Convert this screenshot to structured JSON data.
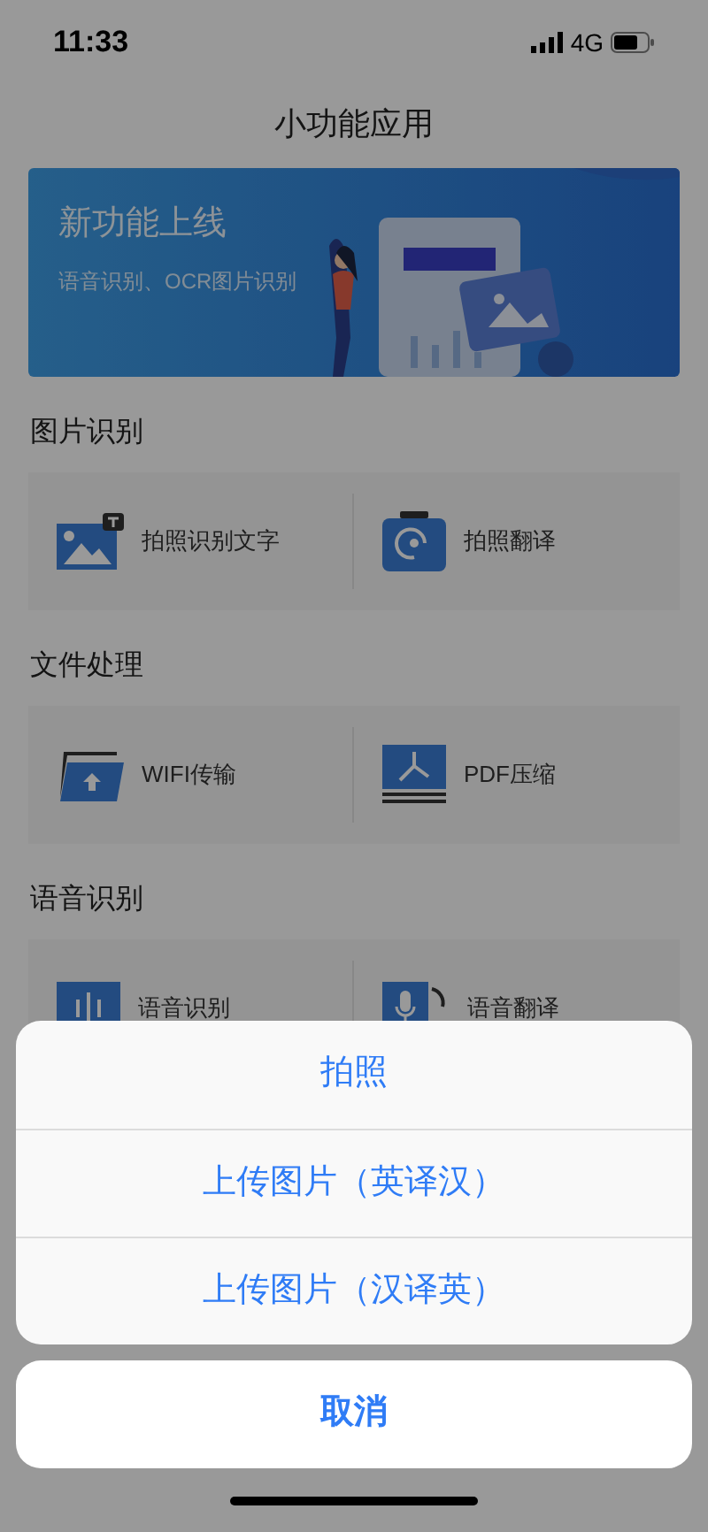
{
  "status_bar": {
    "time": "11:33",
    "network": "4G"
  },
  "title": "小功能应用",
  "banner": {
    "headline": "新功能上线",
    "subtitle": "语音识别、OCR图片识别"
  },
  "sections": [
    {
      "title": "图片识别",
      "items": [
        {
          "label": "拍照识别文字",
          "kind": "phototext"
        },
        {
          "label": "拍照翻译",
          "kind": "cameratranslate"
        }
      ]
    },
    {
      "title": "文件处理",
      "items": [
        {
          "label": "WIFI传输",
          "kind": "wifi"
        },
        {
          "label": "PDF压缩",
          "kind": "pdf"
        }
      ]
    },
    {
      "title": "语音识别",
      "items": [
        {
          "label": "语音识别",
          "kind": "voice"
        },
        {
          "label": "语音翻译",
          "kind": "voicetranslate"
        }
      ]
    }
  ],
  "action_sheet": {
    "options": [
      "拍照",
      "上传图片（英译汉）",
      "上传图片（汉译英）"
    ],
    "cancel": "取消"
  }
}
